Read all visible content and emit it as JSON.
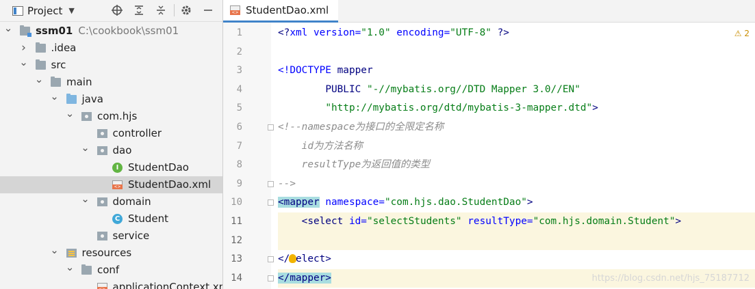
{
  "project_panel": {
    "title": "Project",
    "tree": [
      {
        "label": "ssm01",
        "path": "C:\\cookbook\\ssm01",
        "icon": "module-icon",
        "expanded": true,
        "level": 0
      },
      {
        "label": ".idea",
        "icon": "folder-icon",
        "expanded": false,
        "level": 1
      },
      {
        "label": "src",
        "icon": "folder-icon",
        "expanded": true,
        "level": 1
      },
      {
        "label": "main",
        "icon": "folder-icon",
        "expanded": true,
        "level": 2
      },
      {
        "label": "java",
        "icon": "source-folder-icon",
        "expanded": true,
        "level": 3
      },
      {
        "label": "com.hjs",
        "icon": "package-icon",
        "expanded": true,
        "level": 4
      },
      {
        "label": "controller",
        "icon": "package-icon",
        "expanded": null,
        "level": 5
      },
      {
        "label": "dao",
        "icon": "package-icon",
        "expanded": true,
        "level": 5
      },
      {
        "label": "StudentDao",
        "icon": "interface-icon",
        "expanded": null,
        "level": 6
      },
      {
        "label": "StudentDao.xml",
        "icon": "xml-file-icon",
        "expanded": null,
        "level": 6,
        "selected": true
      },
      {
        "label": "domain",
        "icon": "package-icon",
        "expanded": true,
        "level": 5
      },
      {
        "label": "Student",
        "icon": "class-icon",
        "expanded": null,
        "level": 6
      },
      {
        "label": "service",
        "icon": "package-icon",
        "expanded": null,
        "level": 5
      },
      {
        "label": "resources",
        "icon": "resources-folder-icon",
        "expanded": true,
        "level": 3
      },
      {
        "label": "conf",
        "icon": "folder-icon",
        "expanded": true,
        "level": 4
      },
      {
        "label": "applicationContext.xml",
        "icon": "xml-file-icon",
        "expanded": null,
        "level": 5
      }
    ]
  },
  "editor": {
    "tab_label": "StudentDao.xml",
    "warning_badge": "2",
    "watermark": "https://blog.csdn.net/hjs_75187712",
    "lines": [
      {
        "num": "1",
        "segments": [
          [
            "tag",
            "<?"
          ],
          [
            "attr",
            "xml version="
          ],
          [
            "val",
            "\"1.0\""
          ],
          [
            "attr",
            " encoding="
          ],
          [
            "val",
            "\"UTF-8\""
          ],
          [
            "tag",
            " ?>"
          ]
        ]
      },
      {
        "num": "2",
        "segments": []
      },
      {
        "num": "3",
        "segments": [
          [
            "attr",
            "<!DOCTYPE "
          ],
          [
            "tag",
            "mapper"
          ]
        ]
      },
      {
        "num": "4",
        "segments": [
          [
            "plain",
            "        "
          ],
          [
            "tag",
            "PUBLIC "
          ],
          [
            "val",
            "\"-//mybatis.org//DTD Mapper 3.0//EN\""
          ]
        ]
      },
      {
        "num": "5",
        "segments": [
          [
            "plain",
            "        "
          ],
          [
            "val",
            "\"http://mybatis.org/dtd/mybatis-3-mapper.dtd\""
          ],
          [
            "tag",
            ">"
          ]
        ]
      },
      {
        "num": "6",
        "segments": [
          [
            "cmt",
            "<!--namespace为接口的全限定名称"
          ]
        ]
      },
      {
        "num": "7",
        "segments": [
          [
            "cmt",
            "    id为方法名称"
          ]
        ]
      },
      {
        "num": "8",
        "segments": [
          [
            "cmt",
            "    resultType为返回值的类型"
          ]
        ]
      },
      {
        "num": "9",
        "segments": [
          [
            "cmt",
            "-->"
          ]
        ]
      },
      {
        "num": "10",
        "segments": [
          [
            "brk",
            "<mapper"
          ],
          [
            "attr",
            " namespace="
          ],
          [
            "val",
            "\"com.hjs.dao.StudentDao\""
          ],
          [
            "tag",
            ">"
          ]
        ]
      },
      {
        "num": "11",
        "segments": [
          [
            "plain",
            "    "
          ],
          [
            "tag",
            "<select "
          ],
          [
            "attr",
            "id="
          ],
          [
            "val",
            "\"selectStudents\""
          ],
          [
            "attr",
            " resultType="
          ],
          [
            "val",
            "\"com.hjs.domain.Student\""
          ],
          [
            "tag",
            ">"
          ]
        ]
      },
      {
        "num": "12",
        "segments": []
      },
      {
        "num": "13",
        "segments": [
          [
            "tag",
            "</select>"
          ]
        ]
      },
      {
        "num": "14",
        "segments": [
          [
            "brk",
            "</mapper>"
          ]
        ]
      }
    ]
  }
}
